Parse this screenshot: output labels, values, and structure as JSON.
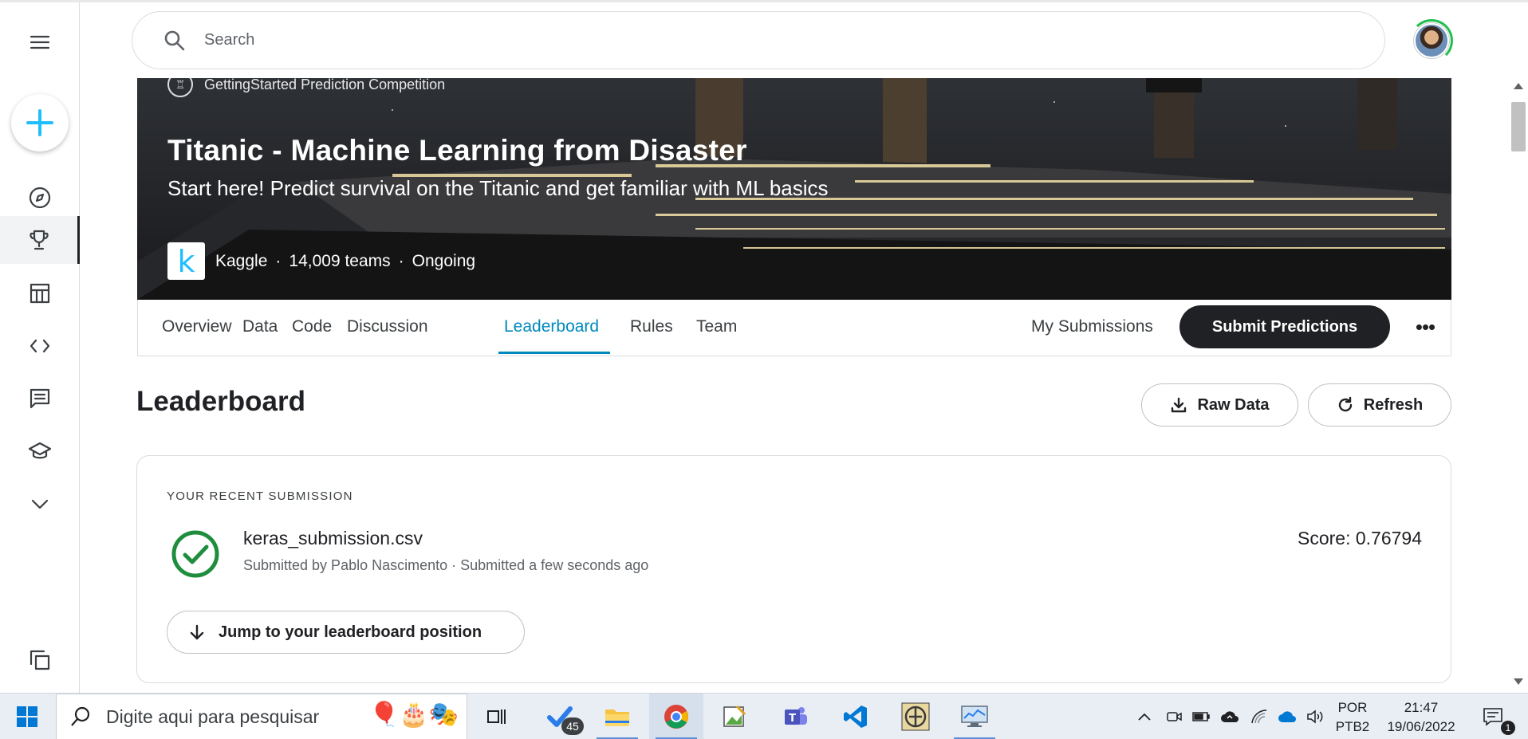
{
  "search": {
    "placeholder": "Search"
  },
  "sidebar": {
    "items": [
      {
        "name": "menu",
        "icon": "hamburger-menu-icon"
      },
      {
        "name": "create",
        "icon": "plus-icon"
      },
      {
        "name": "home",
        "icon": "compass-icon"
      },
      {
        "name": "competitions",
        "icon": "trophy-icon",
        "active": true
      },
      {
        "name": "datasets",
        "icon": "table-icon"
      },
      {
        "name": "code",
        "icon": "code-icon"
      },
      {
        "name": "discussions",
        "icon": "comment-icon"
      },
      {
        "name": "learn",
        "icon": "graduation-cap-icon"
      },
      {
        "name": "more",
        "icon": "chevron-down-icon"
      },
      {
        "name": "recently-viewed",
        "icon": "copy-stack-icon"
      }
    ]
  },
  "banner": {
    "competition_type": "GettingStarted Prediction Competition",
    "title": "Titanic - Machine Learning from Disaster",
    "subtitle": "Start here! Predict survival on the Titanic and get familiar with ML basics",
    "logo_letter": "k",
    "host": "Kaggle",
    "teams": "14,009 teams",
    "status": "Ongoing",
    "separator": "·"
  },
  "tabs": {
    "items": [
      "Overview",
      "Data",
      "Code",
      "Discussion",
      "Leaderboard",
      "Rules",
      "Team"
    ],
    "active": "Leaderboard",
    "my_submissions": "My Submissions",
    "submit": "Submit Predictions",
    "more": "•••"
  },
  "leaderboard": {
    "title": "Leaderboard",
    "raw_data": "Raw Data",
    "refresh": "Refresh"
  },
  "submission": {
    "heading": "YOUR RECENT SUBMISSION",
    "filename": "keras_submission.csv",
    "meta": "Submitted by Pablo Nascimento · Submitted a few seconds ago",
    "score": "Score: 0.76794",
    "jump": "Jump to your leaderboard position"
  },
  "taskbar": {
    "search_placeholder": "Digite aqui para pesquisar",
    "todo_badge": "45",
    "language": "POR",
    "layout": "PTB2",
    "time": "21:47",
    "date": "19/06/2022",
    "notifications": "1"
  },
  "colors": {
    "accent": "#008abc",
    "kaggle_blue": "#20beff",
    "success": "#1e8e3e",
    "dark_button": "#202124"
  }
}
